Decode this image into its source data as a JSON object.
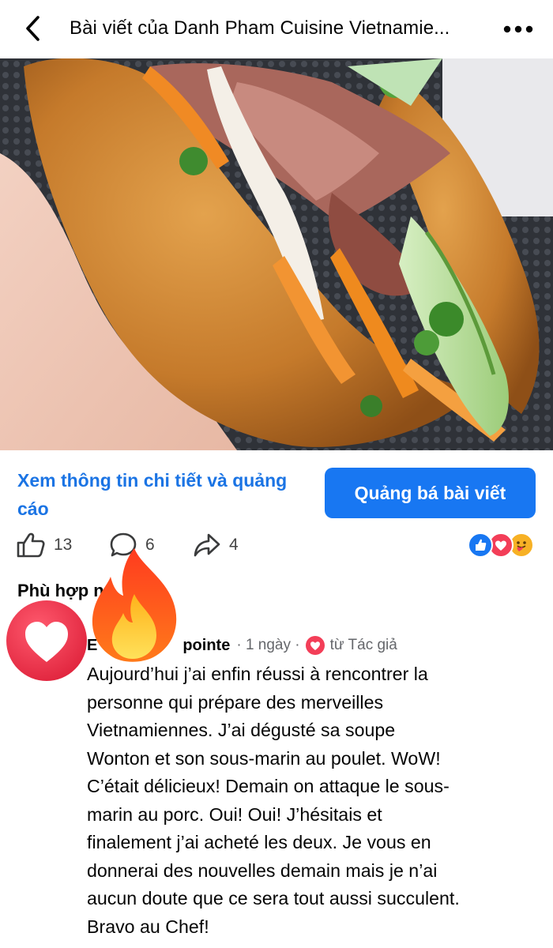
{
  "header": {
    "title": "Bài viết của Danh Pham Cuisine Vietnamie...",
    "back_icon": "chevron-left-icon",
    "more_icon": "more-horizontal-icon"
  },
  "post": {
    "image_icon": "banh-mi-sandwich-photo"
  },
  "promo": {
    "detail_link": "Xem thông tin chi tiết và quảng cáo",
    "boost_label": "Quảng bá bài viết",
    "accent": "#1877f2"
  },
  "stats": {
    "likes": "13",
    "comments": "6",
    "shares": "4",
    "reactions": [
      "like",
      "love",
      "care"
    ]
  },
  "comments_section": {
    "filter_label": "Phù hợp n",
    "comment": {
      "author": "E",
      "author_tail": "pointe",
      "time": "· 1 ngày ·",
      "badge": "từ Tác giả",
      "text": "Aujourd’hui j’ai enfin réussi à rencontrer la\npersonne qui prépare des merveilles\nVietnamiennes.  J’ai dégusté sa soupe\nWonton et son sous-marin au poulet. WoW!\nC’était délicieux!  Demain on attaque le sous-\nmarin au porc. Oui! Oui! J’hésitais et\nfinalement j’ai acheté les deux.  Je vous en\ndonnerai des nouvelles demain mais je n’ai\naucun doute que ce sera tout aussi succulent.\nBravo au Chef!"
    }
  },
  "overlays": {
    "heart_icon": "heart-reaction-icon",
    "fire_icon": "fire-emoji-icon"
  }
}
